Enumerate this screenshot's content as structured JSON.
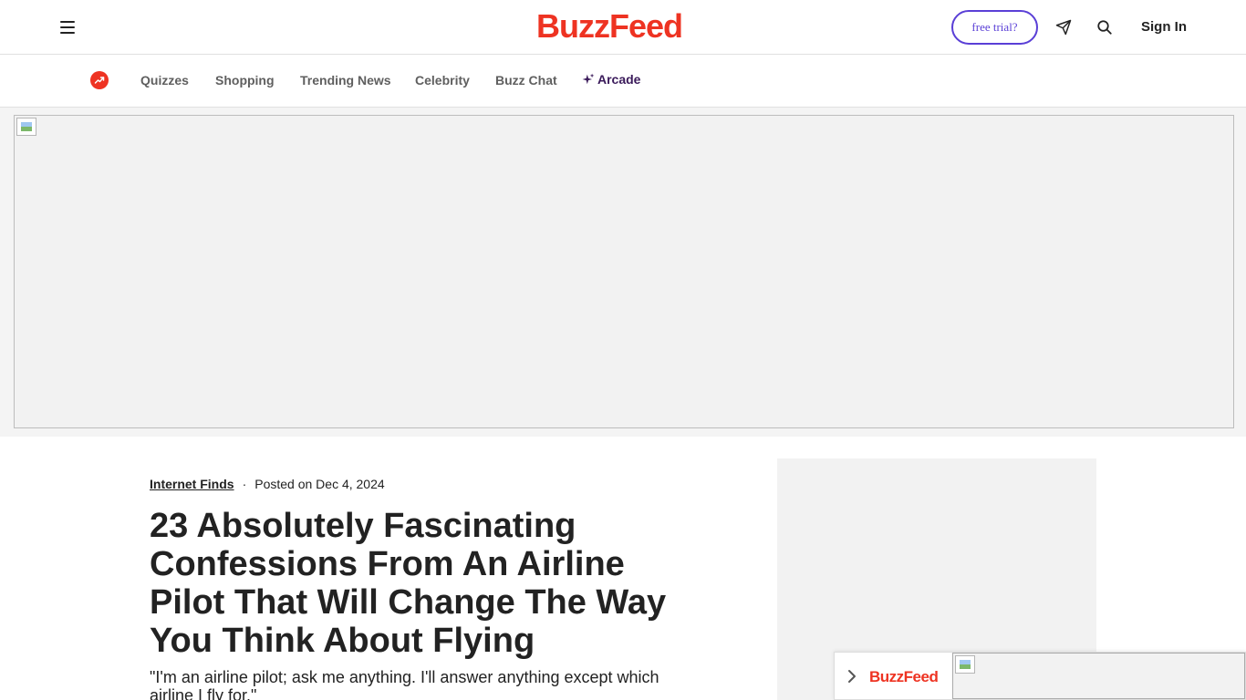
{
  "header": {
    "logo": "BuzzFeed",
    "trial_label": "free trial?",
    "signin_label": "Sign In",
    "icons": [
      "menu-icon",
      "send-icon",
      "search-icon"
    ]
  },
  "nav": {
    "trending_icon": "trending-icon",
    "items": [
      {
        "label": "Quizzes"
      },
      {
        "label": "Shopping"
      },
      {
        "label": "Trending News"
      },
      {
        "label": "Celebrity"
      },
      {
        "label": "Buzz Chat"
      },
      {
        "label": "Arcade"
      }
    ]
  },
  "article": {
    "category": "Internet Finds",
    "separator": "·",
    "posted": "Posted on Dec 4, 2024",
    "headline": "23 Absolutely Fascinating Confessions From An Airline Pilot That Will Change The Way You Think About Flying",
    "dek": "\"I'm an airline pilot; ask me anything. I'll answer anything except which airline I fly for.\""
  },
  "sticky": {
    "logo": "BuzzFeed"
  },
  "colors": {
    "brand_red": "#ee3322",
    "accent_purple": "#5a3fd6",
    "arcade_purple": "#3a1a5a"
  }
}
